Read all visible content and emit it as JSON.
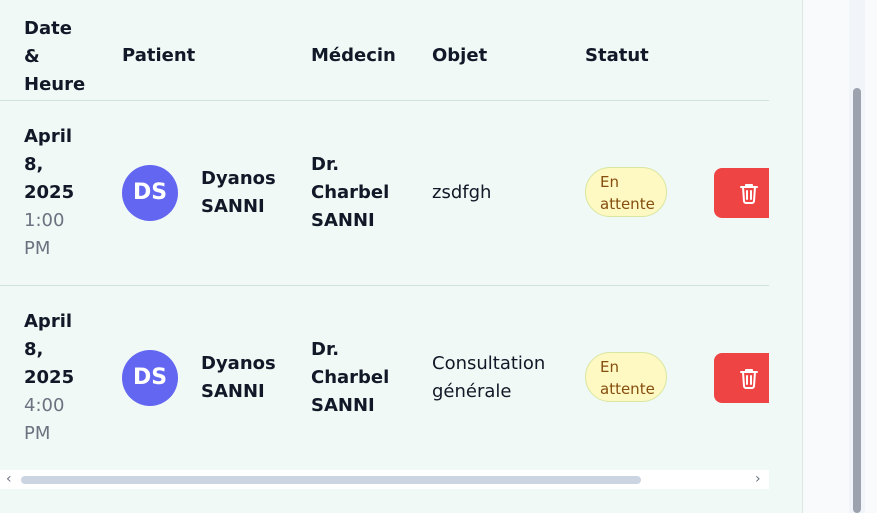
{
  "headers": {
    "date_line1": "Date",
    "date_line2": "&",
    "date_line3": "Heure",
    "patient": "Patient",
    "medecin": "Médecin",
    "objet": "Objet",
    "statut": "Statut"
  },
  "rows": [
    {
      "date_l1": "April",
      "date_l2": "8,",
      "date_l3": "2025",
      "time_l1": "1:00",
      "time_l2": "PM",
      "avatar": "DS",
      "patient_l1": "Dyanos",
      "patient_l2": "SANNI",
      "doctor_l1": "Dr.",
      "doctor_l2": "Charbel",
      "doctor_l3": "SANNI",
      "objet_l1": "zsdfgh",
      "objet_l2": "",
      "status_l1": "En",
      "status_l2": "attente"
    },
    {
      "date_l1": "April",
      "date_l2": "8,",
      "date_l3": "2025",
      "time_l1": "4:00",
      "time_l2": "PM",
      "avatar": "DS",
      "patient_l1": "Dyanos",
      "patient_l2": "SANNI",
      "doctor_l1": "Dr.",
      "doctor_l2": "Charbel",
      "doctor_l3": "SANNI",
      "objet_l1": "Consultation",
      "objet_l2": "générale",
      "status_l1": "En",
      "status_l2": "attente"
    }
  ],
  "scrollbar": {
    "left_arrow": "‹",
    "right_arrow": "›"
  },
  "colors": {
    "panel_bg": "#f0f9f5",
    "avatar_bg": "#6366f1",
    "badge_bg": "#fef9c3",
    "badge_text": "#854d0e",
    "delete_bg": "#ef4444"
  },
  "icons": {
    "delete": "trash-icon"
  }
}
